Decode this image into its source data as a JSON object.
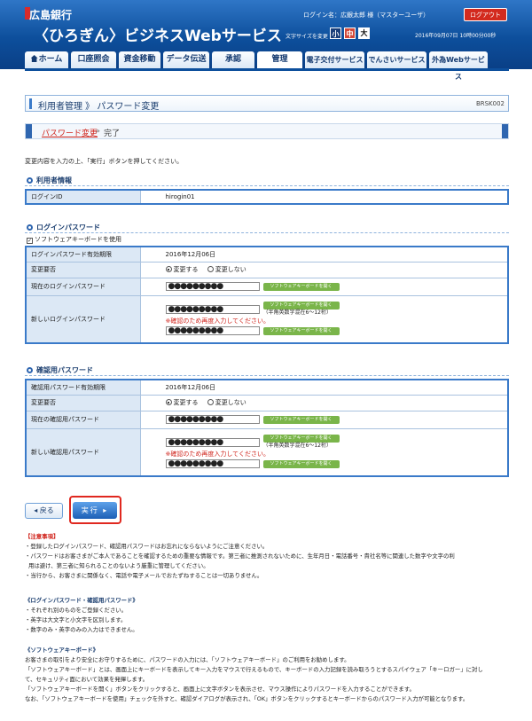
{
  "header": {
    "bank_name": "広島銀行",
    "service_name": "〈ひろぎん〉ビジネスWebサービス",
    "login_name": "ログイン名：広銀太郎 様（マスターユーザ）",
    "logout_label": "ログアウト",
    "font_size_label": "文字サイズを変更",
    "font_small": "小",
    "font_medium": "中",
    "font_large": "大",
    "datetime": "2016年09月07日 10時00分00秒"
  },
  "nav": {
    "tabs": [
      {
        "label": "ホーム"
      },
      {
        "label": "口座照会"
      },
      {
        "label": "資金移動"
      },
      {
        "label": "データ伝送"
      },
      {
        "label": "承認"
      },
      {
        "label": "管理"
      },
      {
        "label": "電子交付サービス"
      },
      {
        "label": "でんさいサービス"
      },
      {
        "label": "外為Webサービス"
      }
    ]
  },
  "page": {
    "title": "利用者管理 》 パスワード変更",
    "code": "BRSK002",
    "step_current": "パスワード変更",
    "step_sep": "»",
    "step_next": "完了",
    "instruction": "変更内容を入力の上、「実行」ボタンを押してください。"
  },
  "user_info": {
    "section_title": "利用者情報",
    "login_id_label": "ログインID",
    "login_id_value": "hirogin01"
  },
  "login_pw": {
    "section_title": "ログインパスワード",
    "soft_kb_check_label": "ソフトウェアキーボードを使用",
    "expiry_label": "ログインパスワード有効期限",
    "expiry_value": "2016年12月06日",
    "change_req_label": "変更要否",
    "opt_change": "変更する",
    "opt_nochange": "変更しない",
    "current_label": "現在のログインパスワード",
    "current_value": "●●●●●●●●●",
    "new_label": "新しいログインパスワード",
    "new_value": "●●●●●●●●●",
    "confirm_value": "●●●●●●●●●",
    "rule_text": "（半角英数字混在6～12桁）",
    "confirm_note": "※確認のため再度入力してください。",
    "soft_kb_button": "ソフトウェアキーボードを開く"
  },
  "confirm_pw": {
    "section_title": "確認用パスワード",
    "expiry_label": "確認用パスワード有効期限",
    "expiry_value": "2016年12月06日",
    "change_req_label": "変更要否",
    "opt_change": "変更する",
    "opt_nochange": "変更しない",
    "current_label": "現在の確認用パスワード",
    "current_value": "●●●●●●●●●",
    "new_label": "新しい確認用パスワード",
    "new_value": "●●●●●●●●●",
    "confirm_value": "●●●●●●●●●",
    "rule_text": "（半角英数字混在6～12桁）",
    "confirm_note": "※確認のため再度入力してください。",
    "soft_kb_button": "ソフトウェアキーボードを開く"
  },
  "buttons": {
    "back": "戻る",
    "execute": "実行"
  },
  "notes": {
    "caution_head": "【注意事項】",
    "caution_1": "・登録したログインパスワード、確認用パスワードはお忘れにならないようにご注意ください。",
    "caution_2": "・パスワードはお客さまがご本人であることを確認するための重要な情報です。第三者に推測されないために、生年月日・電話番号・貴社名等に関連した数字や文字の利",
    "caution_2b": "用は避け、第三者に知られることのないよう厳重に管理してください。",
    "caution_3": "・当行から、お客さまに関係なく、電話や電子メールでおたずねすることは一切ありません。",
    "pw_head": "《ログインパスワード・確認用パスワード》",
    "pw_1": "・それぞれ別のものをご登録ください。",
    "pw_2": "・英字は大文字と小文字を区別します。",
    "pw_3": "・数字のみ・英字のみの入力はできません。",
    "kb_head": "《ソフトウェアキーボード》",
    "kb_1": "お客さまの取引をより安全にお守りするために、パスワードの入力には、「ソフトウェアキーボード」のご利用をお勧めします。",
    "kb_2": "「ソフトウェアキーボード」とは、画面上にキーボードを表示してキー入力をマウスで行えるもので、キーボードの入力記録を読み取ろうとするスパイウェア「キーロガー」に対し",
    "kb_2b": "て、セキュリティ面において効果を発揮します。",
    "kb_3": "「ソフトウェアキーボードを開く」ボタンをクリックすると、画面上に文字ボタンを表示させ、マウス操作によりパスワードを入力することができます。",
    "kb_4": "なお、「ソフトウェアキーボードを使用」チェックを外すと、確認ダイアログが表示され、「OK」ボタンをクリックするとキーボードからのパスワード入力が可能となります。"
  },
  "colors": {
    "header_blue": "#0d4f9c",
    "accent_red": "#d0241c",
    "soft_kb_green": "#7ab54a",
    "label_bg": "#dce8f5"
  }
}
